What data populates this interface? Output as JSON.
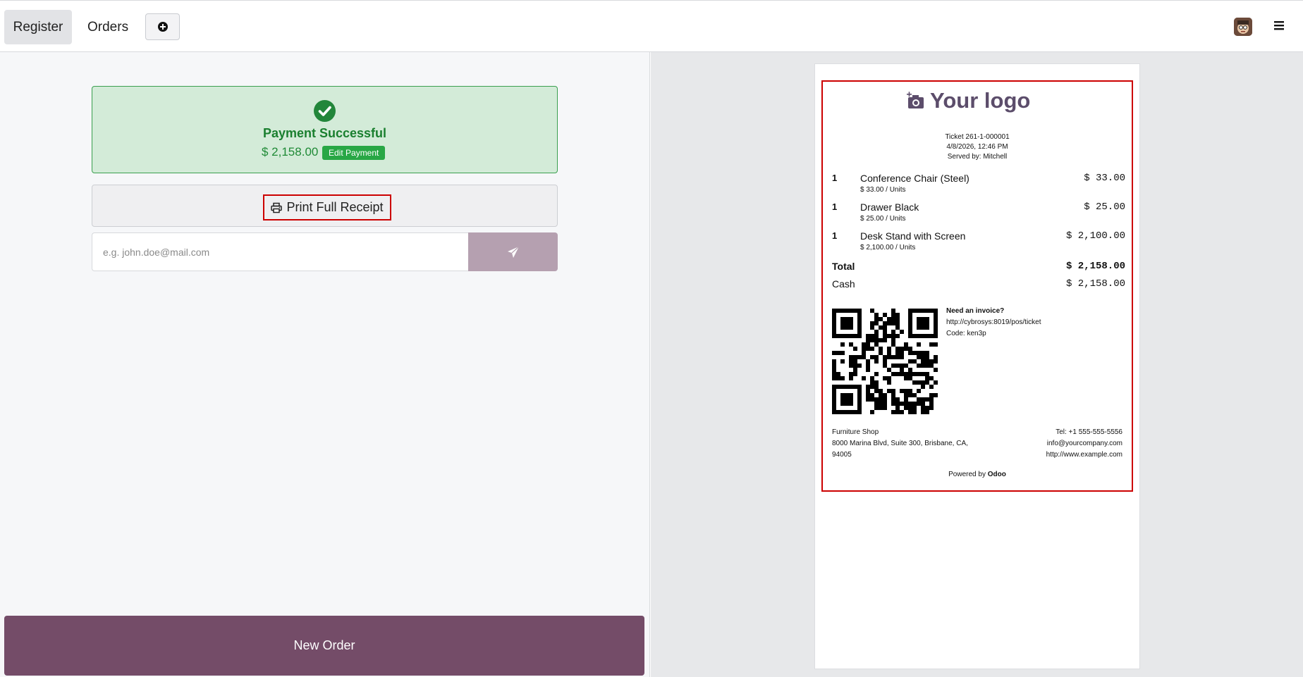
{
  "topbar": {
    "tab_register": "Register",
    "tab_orders": "Orders"
  },
  "payment": {
    "title": "Payment Successful",
    "amount": "$ 2,158.00",
    "edit_label": "Edit Payment"
  },
  "print": {
    "label": "Print Full Receipt"
  },
  "email": {
    "placeholder": "e.g. john.doe@mail.com"
  },
  "new_order": {
    "label": "New Order"
  },
  "receipt": {
    "logo_text": "Your logo",
    "ticket": "Ticket 261-1-000001",
    "datetime": "4/8/2026, 12:46 PM",
    "served_by": "Served by: Mitchell",
    "lines": [
      {
        "qty": "1",
        "name": "Conference Chair (Steel)",
        "unit": "$ 33.00 / Units",
        "price": "$ 33.00"
      },
      {
        "qty": "1",
        "name": "Drawer Black",
        "unit": "$ 25.00 / Units",
        "price": "$ 25.00"
      },
      {
        "qty": "1",
        "name": "Desk Stand with Screen",
        "unit": "$ 2,100.00 / Units",
        "price": "$ 2,100.00"
      }
    ],
    "total_label": "Total",
    "total_value": "$ 2,158.00",
    "cash_label": "Cash",
    "cash_value": "$ 2,158.00",
    "invoice_title": "Need an invoice?",
    "invoice_url": "http://cybrosys:8019/pos/ticket",
    "invoice_code": "Code: ken3p",
    "company_name": "Furniture Shop",
    "address1": "8000 Marina Blvd, Suite 300, Brisbane, CA,",
    "address2": "94005",
    "tel": "Tel: +1 555-555-5556",
    "company_email": "info@yourcompany.com",
    "website": "http://www.example.com",
    "powered_prefix": "Powered by",
    "powered_brand": "Odoo"
  },
  "colors": {
    "primary": "#744c68",
    "success_bg": "#d3ebd8",
    "success_text": "#1a7f2f",
    "highlight": "#cc0000"
  }
}
